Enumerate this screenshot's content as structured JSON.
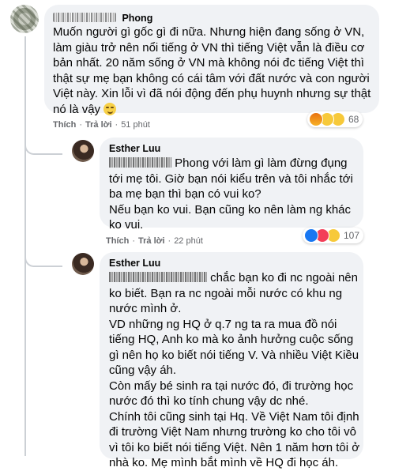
{
  "comments": [
    {
      "author_name": "Phong",
      "body": [
        "Muốn người gì gốc gì đi nữa. Nhưng hiện đang sống ở VN, làm giàu trở nên nổi tiếng ở VN thì tiếng Việt vẫn là điều cơ bản nhất. 20 năm sống ở VN mà không nói đc tiếng Việt thì thật sự mẹ bạn không có cái tâm với đất nước và con người Việt này. Xin lỗi vì đã nói động đến phụ huynh nhưng sự thật nó là vậy"
      ],
      "actions": {
        "like": "Thích",
        "reply": "Trả lời",
        "time": "51 phút"
      },
      "reaction_count": "68",
      "reactions": [
        "angry-reaction",
        "sad-reaction",
        "haha-reaction"
      ]
    },
    {
      "author_name": "Esther Luu",
      "mention_name": "Phong",
      "body": [
        " với làm gì làm đừng đụng tới mẹ tôi. Giờ bạn nói kiểu trên và tôi nhắc tới ba mẹ bạn thì bạn có vui ko?",
        "Nếu bạn ko vui. Bạn cũng ko nên làm ng khác ko vui."
      ],
      "actions": {
        "like": "Thích",
        "reply": "Trả lời",
        "time": "22 phút"
      },
      "reaction_count": "107",
      "reactions": [
        "like-reaction",
        "love-reaction",
        "haha-reaction"
      ]
    },
    {
      "author_name": "Esther Luu",
      "body": [
        " chắc bạn ko đi nc ngoài nên ko biết. Bạn ra nc ngoài mỗi nước có khu ng nước mình ở.",
        "VD những ng HQ ở q.7 ng ta ra mua đồ nói tiếng HQ, Anh ko mà ko ảnh hưởng cuộc sống gì nên họ ko biết nói tiếng V. Và nhiều Việt Kiều cũng vậy áh.",
        "Còn mấy bé sinh ra tại nước đó, đi trường học nước đó thì ko tính chung vậy dc nhé.",
        "Chính tôi cũng sinh tại Hq. Về Việt Nam tôi định đi trường Việt Nam nhưng trường ko cho tôi vô vì tôi ko biết nói tiếng Việt. Nên 1 năm hơn tôi ở nhà ko. Mẹ mình bắt mình về HQ đi học áh."
      ]
    }
  ],
  "colors": {
    "bubble": "#f0f2f5",
    "meta_text": "#65676b",
    "thread_line": "#ccd0d5",
    "like_blue": "#1877f2",
    "love_red": "#f33e58",
    "angry_orange": "#e9710f",
    "emoji_yellow": "#f7b125"
  }
}
